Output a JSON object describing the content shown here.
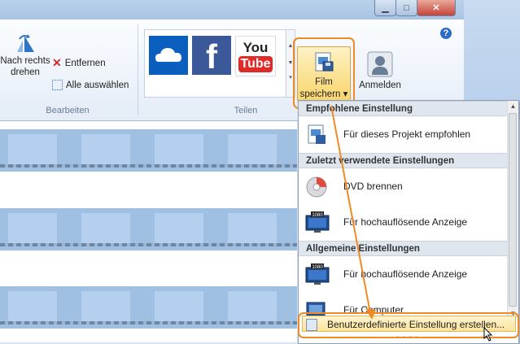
{
  "window": {
    "minimize_icon": "minimize-icon",
    "maximize_icon": "maximize-icon",
    "close_icon": "close-icon",
    "help_label": "?"
  },
  "ribbon": {
    "rotate_label_1": "Nach rechts",
    "rotate_label_2": "drehen",
    "remove_label": "Entfernen",
    "select_all_label": "Alle auswählen",
    "group_edit": "Bearbeiten",
    "group_share": "Teilen",
    "share_tiles": [
      "OneDrive",
      "Facebook",
      "YouTube"
    ],
    "youtube_you": "You",
    "youtube_tube": "Tube",
    "film_label_1": "Film",
    "film_label_2": "speichern",
    "film_arrow": "▾",
    "login_label": "Anmelden"
  },
  "menu": {
    "sections": [
      {
        "header": "Empfohlene Einstellung",
        "items": [
          {
            "label": "Für dieses Projekt empfohlen",
            "icon": "project-settings-icon"
          }
        ]
      },
      {
        "header": "Zuletzt verwendete Einstellungen",
        "items": [
          {
            "label": "DVD brennen",
            "icon": "dvd-icon"
          },
          {
            "label": "Für hochauflösende Anzeige",
            "icon": "hd-monitor-icon",
            "badge": "1080"
          }
        ]
      },
      {
        "header": "Allgemeine Einstellungen",
        "items": [
          {
            "label": "Für hochauflösende Anzeige",
            "icon": "hd-monitor-icon",
            "badge": "1080"
          },
          {
            "label": "Für Computer",
            "icon": "computer-icon"
          }
        ]
      }
    ],
    "custom_label": "Benutzerdefinierte Einstellung erstellen...",
    "grip": "• • • •"
  },
  "colors": {
    "highlight_ring": "#f08a24",
    "accent": "#2e6bc4"
  }
}
